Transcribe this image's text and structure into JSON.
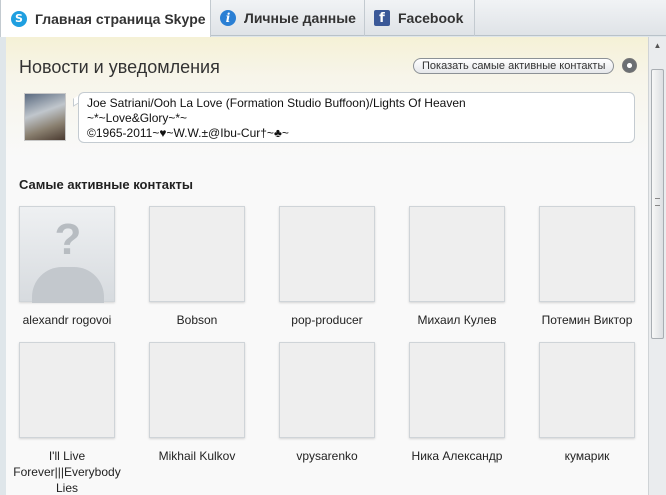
{
  "tabs": [
    {
      "label": "Главная страница Skype",
      "icon": "skype-icon",
      "active": true
    },
    {
      "label": "Личные данные",
      "icon": "info-icon",
      "active": false
    },
    {
      "label": "Facebook",
      "icon": "facebook-icon",
      "active": false
    }
  ],
  "news": {
    "heading": "Новости и уведомления",
    "show_active_button": "Показать самые активные контакты",
    "mood_lines": [
      "Joe Satriani/Ooh La Love (Formation Studio Buffoon)/Lights Of Heaven",
      "~*~Love&Glory~*~",
      "©1965-2011~♥~W.W.±@Ibu-Cur†~♣~"
    ]
  },
  "contacts": {
    "title": "Самые активные контакты",
    "items": [
      {
        "name": "alexandr rogovoi"
      },
      {
        "name": "Bobson"
      },
      {
        "name": "pop-producer"
      },
      {
        "name": "Михаил Кулев"
      },
      {
        "name": "Потемин Виктор"
      },
      {
        "name": "I'll Live Forever|||Everybody Lies"
      },
      {
        "name": "Mikhail Kulkov"
      },
      {
        "name": "vpysarenko"
      },
      {
        "name": "Ника Александр"
      },
      {
        "name": "кумарик"
      }
    ]
  },
  "colors": {
    "accent": "#1f9fe0",
    "facebook": "#3b5998"
  }
}
